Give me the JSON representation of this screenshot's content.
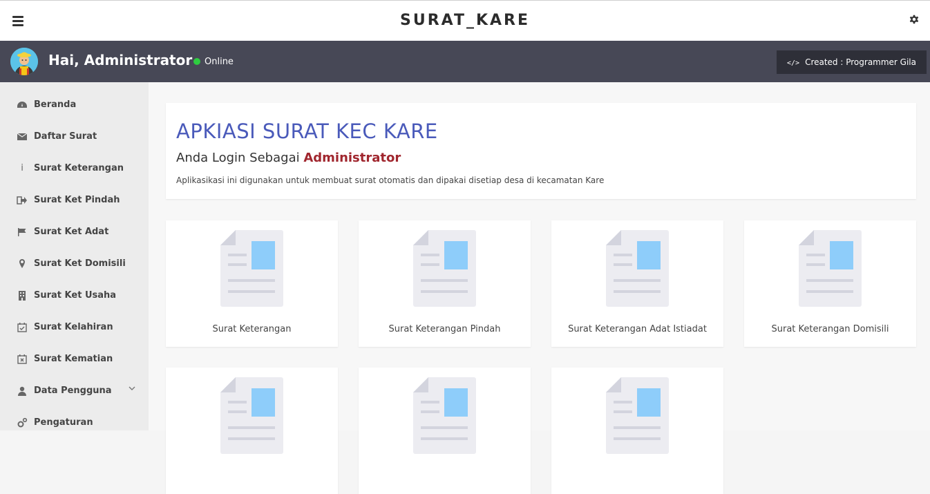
{
  "header": {
    "title": "SURAT_KARE",
    "menu_icon": "hamburger-icon",
    "settings_icon": "gear-icon"
  },
  "userbar": {
    "greeting": "Hai, Administrator",
    "status": "Online",
    "status_color": "#2ecc40",
    "created_label": "Created : Programmer Gila",
    "background": "#474856"
  },
  "sidebar": {
    "items": [
      {
        "label": "Beranda",
        "icon": "dashboard-icon"
      },
      {
        "label": "Daftar Surat",
        "icon": "envelope-icon"
      },
      {
        "label": "Surat Keterangan",
        "icon": "info-icon"
      },
      {
        "label": "Surat Ket Pindah",
        "icon": "sign-out-icon"
      },
      {
        "label": "Surat Ket Adat",
        "icon": "flag-icon"
      },
      {
        "label": "Surat Ket Domisili",
        "icon": "map-marker-icon"
      },
      {
        "label": "Surat Ket Usaha",
        "icon": "building-icon"
      },
      {
        "label": "Surat Kelahiran",
        "icon": "calendar-check-icon"
      },
      {
        "label": "Surat Kematian",
        "icon": "calendar-times-icon"
      },
      {
        "label": "Data Pengguna",
        "icon": "user-icon"
      },
      {
        "label": "Pengaturan",
        "icon": "cogs-icon"
      }
    ]
  },
  "hero": {
    "title": "APKIASI SURAT KEC KARE",
    "login_prefix": "Anda Login Sebagai",
    "login_role": "Administrator",
    "description": "Aplikasikasi ini digunakan untuk membuat surat otomatis dan dipakai disetiap desa di kecamatan Kare",
    "title_color": "#4a5aba",
    "role_color": "#a0262e"
  },
  "cards": [
    {
      "label": "Surat Keterangan"
    },
    {
      "label": "Surat Keterangan Pindah"
    },
    {
      "label": "Surat Keterangan Adat Istiadat"
    },
    {
      "label": "Surat Keterangan Domisili"
    },
    {
      "label": ""
    },
    {
      "label": ""
    },
    {
      "label": ""
    }
  ]
}
